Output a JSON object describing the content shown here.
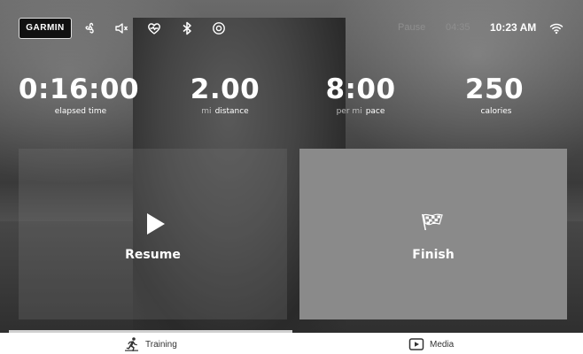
{
  "status_bar": {
    "brand": "GARMIN",
    "pause_label": "Pause",
    "pause_time": "04:35",
    "clock": "10:23 AM",
    "icons": [
      "fan-icon",
      "volume-mute-icon",
      "heart-rate-icon",
      "bluetooth-icon",
      "settings-icon",
      "wifi-icon"
    ]
  },
  "metrics": [
    {
      "value": "0:16:00",
      "unit": "",
      "label": "elapsed time"
    },
    {
      "value": "2.00",
      "unit": "mi",
      "label": "distance"
    },
    {
      "value": "8:00",
      "unit": "per mi",
      "label": "pace"
    },
    {
      "value": "250",
      "unit": "",
      "label": "calories"
    }
  ],
  "actions": {
    "resume_label": "Resume",
    "finish_label": "Finish"
  },
  "tabs": [
    {
      "label": "Training",
      "icon": "runner-icon",
      "active": true
    },
    {
      "label": "Media",
      "icon": "media-play-icon",
      "active": false
    }
  ],
  "colors": {
    "finish_panel": "#8a8a8a",
    "tab_indicator": "#d0d0d0",
    "text": "#ffffff"
  }
}
